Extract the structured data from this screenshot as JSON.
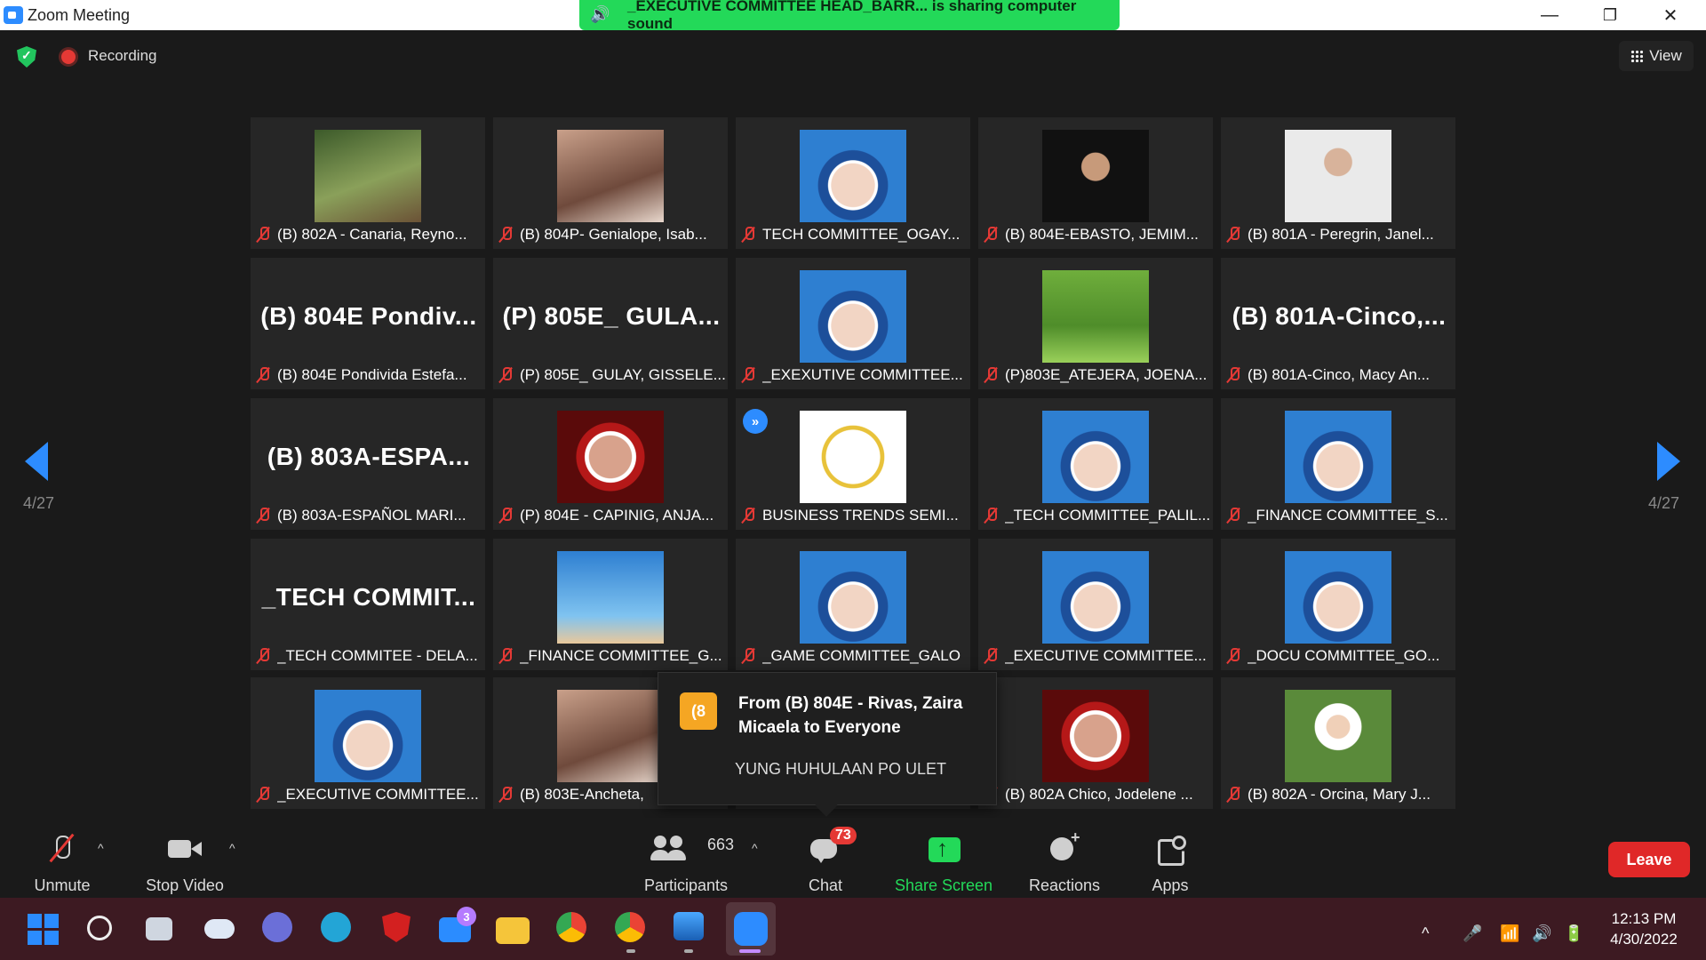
{
  "window": {
    "title": "Zoom Meeting",
    "minimize": "—",
    "restore": "❐",
    "close": "✕"
  },
  "sharing_banner": "_EXECUTIVE COMMITTEE HEAD_BARR... is sharing computer sound",
  "status": {
    "recording_label": "Recording",
    "view_label": "View"
  },
  "pagination": {
    "left": "4/27",
    "right": "4/27"
  },
  "tiles": [
    {
      "name": "(B) 802A - Canaria, Reyno...",
      "photo": "forest-bridge",
      "big": ""
    },
    {
      "name": "(B) 804P- Genialope, Isab...",
      "photo": "selfie",
      "big": ""
    },
    {
      "name": "TECH COMMITTEE_OGAY...",
      "photo": "making-the-natural-frame",
      "big": ""
    },
    {
      "name": "(B) 804E-EBASTO, JEMIM...",
      "photo": "dark-portrait",
      "big": ""
    },
    {
      "name": "(B) 801A - Peregrin, Janel...",
      "photo": "formal-portrait",
      "big": ""
    },
    {
      "name": "(B) 804E Pondivida Estefa...",
      "photo": "",
      "big": "(B)  804E  Pondiv..."
    },
    {
      "name": "(P) 805E_ GULAY, GISSELE...",
      "photo": "",
      "big": "(P)  805E_  GULA..."
    },
    {
      "name": "_EXEXUTIVE COMMITTEE...",
      "photo": "making-the-natural-frame",
      "big": ""
    },
    {
      "name": "(P)803E_ATEJERA, JOENA...",
      "photo": "grass-field",
      "big": ""
    },
    {
      "name": "(B) 801A-Cinco, Macy An...",
      "photo": "",
      "big": "(B)  801A-Cinco,..."
    },
    {
      "name": "(B) 803A-ESPAÑOL MARI...",
      "photo": "",
      "big": "(B)  803A-ESPA..."
    },
    {
      "name": "(P) 804E - CAPINIG, ANJA...",
      "photo": "red-seal-frame",
      "big": ""
    },
    {
      "name": "BUSINESS TRENDS SEMI...",
      "photo": "business-logo",
      "big": "",
      "badge": "»"
    },
    {
      "name": "_TECH COMMITTEE_PALIL...",
      "photo": "making-the-natural-frame",
      "big": ""
    },
    {
      "name": "_FINANCE COMMITTEE_S...",
      "photo": "making-the-natural-frame",
      "big": ""
    },
    {
      "name": "_TECH COMMITEE - DELA...",
      "photo": "",
      "big": "_TECH  COMMIT..."
    },
    {
      "name": "_FINANCE COMMITTEE_G...",
      "photo": "making-the-natural-banner",
      "big": ""
    },
    {
      "name": "_GAME COMMITTEE_GALO",
      "photo": "making-the-natural-frame",
      "big": ""
    },
    {
      "name": "_EXECUTIVE COMMITTEE...",
      "photo": "making-the-natural-frame",
      "big": ""
    },
    {
      "name": "_DOCU COMMITTEE_GO...",
      "photo": "making-the-natural-frame",
      "big": ""
    },
    {
      "name": "_EXECUTIVE COMMITTEE...",
      "photo": "making-the-natural-frame",
      "big": ""
    },
    {
      "name": "(B) 803E-Ancheta,",
      "photo": "selfie",
      "big": ""
    },
    {
      "name": "",
      "photo": "",
      "big": ""
    },
    {
      "name": "(B) 802A Chico, Jodelene ...",
      "photo": "red-seal-frame",
      "big": ""
    },
    {
      "name": "(B) 802A - Orcina, Mary J...",
      "photo": "green-portrait",
      "big": ""
    }
  ],
  "chat_toast": {
    "avatar": "(8",
    "from": "From (B) 804E - Rivas, Zaira Micaela to Everyone",
    "message": "YUNG HUHULAAN PO ULET"
  },
  "controls": {
    "unmute": "Unmute",
    "stop_video": "Stop Video",
    "participants": "Participants",
    "participant_count": "663",
    "chat": "Chat",
    "chat_badge": "73",
    "share_screen": "Share Screen",
    "reactions": "Reactions",
    "apps": "Apps",
    "leave": "Leave"
  },
  "taskbar": {
    "mail_badge": "3",
    "time": "12:13 PM",
    "date": "4/30/2022",
    "apps": [
      "windows-icon",
      "search-icon",
      "task-view-icon",
      "weather-icon",
      "teams-icon",
      "edge-icon",
      "mcafee-icon",
      "mail-icon",
      "file-explorer-icon",
      "chrome-icon",
      "chrome-profile-icon",
      "photos-icon",
      "zoom-icon"
    ]
  },
  "colors": {
    "accent": "#2d8cff",
    "share_green": "#23d959",
    "leave_red": "#e02828",
    "muted_red": "#e53935"
  }
}
